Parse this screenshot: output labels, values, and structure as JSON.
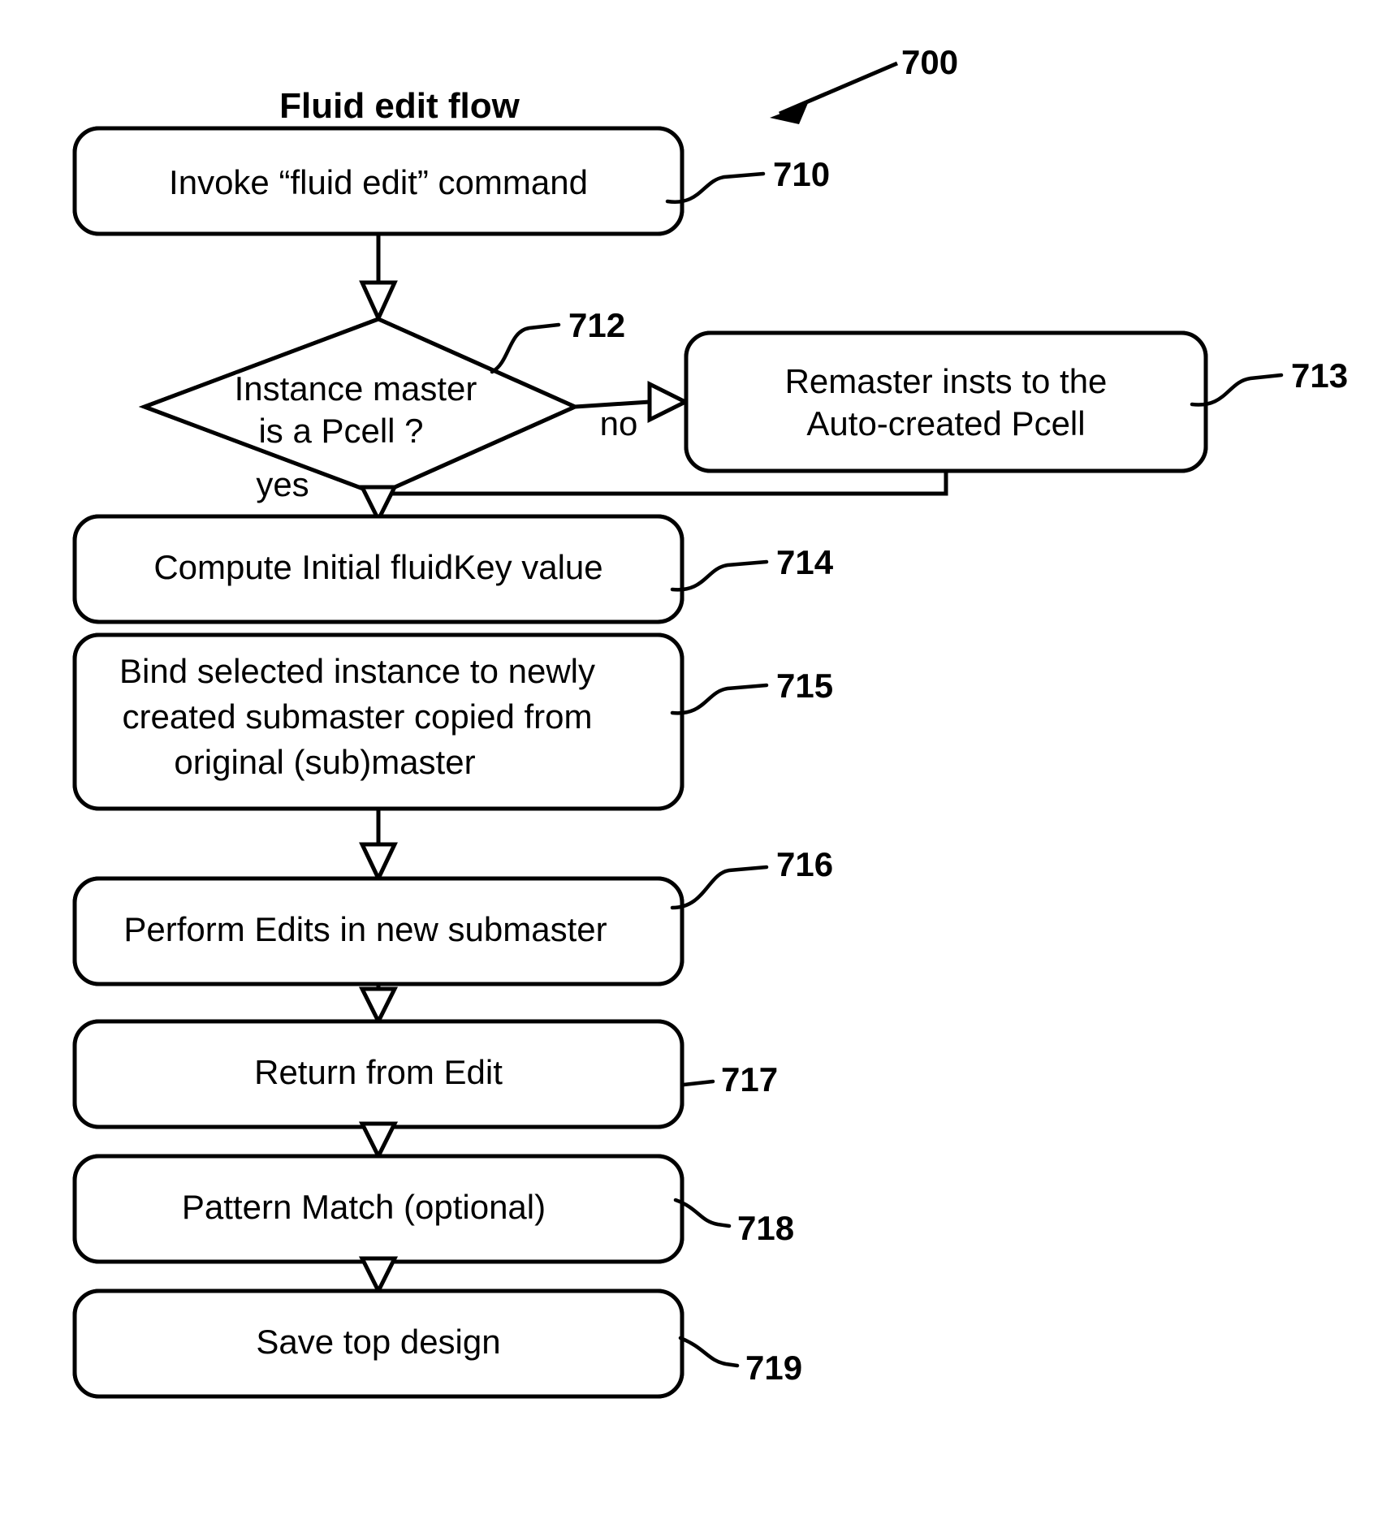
{
  "figure": {
    "title": "Fluid edit flow",
    "figure_ref": "700"
  },
  "nodes": [
    {
      "id": "n710",
      "ref": "710",
      "shape": "rounded-rect",
      "lines": [
        "Invoke “fluid edit” command"
      ]
    },
    {
      "id": "n712",
      "ref": "712",
      "shape": "diamond",
      "lines": [
        "Instance master",
        "is a Pcell ?"
      ]
    },
    {
      "id": "n713",
      "ref": "713",
      "shape": "rounded-rect",
      "lines": [
        "Remaster insts to the",
        "Auto-created Pcell"
      ]
    },
    {
      "id": "n714",
      "ref": "714",
      "shape": "rounded-rect",
      "lines": [
        "Compute Initial fluidKey value"
      ]
    },
    {
      "id": "n715",
      "ref": "715",
      "shape": "rounded-rect",
      "lines": [
        "Bind selected instance to newly",
        "created submaster copied from",
        "original (sub)master"
      ]
    },
    {
      "id": "n716",
      "ref": "716",
      "shape": "rounded-rect",
      "lines": [
        "Perform Edits in new submaster"
      ]
    },
    {
      "id": "n717",
      "ref": "717",
      "shape": "rounded-rect",
      "lines": [
        "Return from Edit"
      ]
    },
    {
      "id": "n718",
      "ref": "718",
      "shape": "rounded-rect",
      "lines": [
        "Pattern Match (optional)"
      ]
    },
    {
      "id": "n719",
      "ref": "719",
      "shape": "rounded-rect",
      "lines": [
        "Save top design"
      ]
    }
  ],
  "branch_labels": {
    "yes": "yes",
    "no": "no"
  },
  "colors": {
    "ink": "#000000",
    "paper": "#ffffff"
  }
}
